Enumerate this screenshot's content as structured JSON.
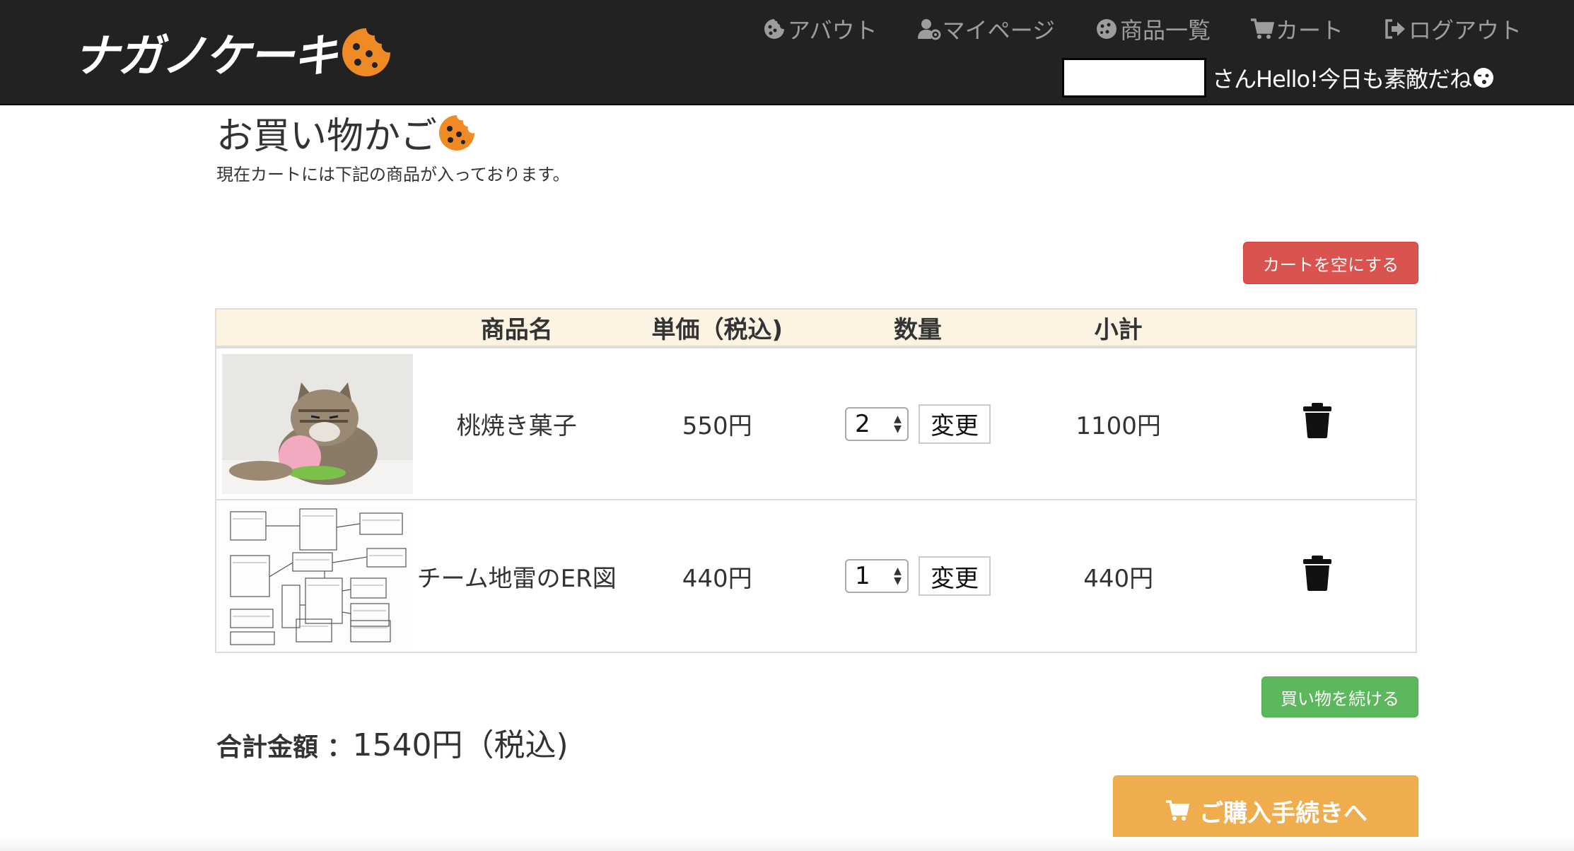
{
  "header": {
    "brand": "ナガノケーキ",
    "nav": [
      {
        "label": "アバウト",
        "icon": "cookie-icon"
      },
      {
        "label": "マイページ",
        "icon": "user-gear-icon"
      },
      {
        "label": "商品一覧",
        "icon": "cookie-icon"
      },
      {
        "label": "カート",
        "icon": "cart-icon"
      },
      {
        "label": "ログアウト",
        "icon": "sign-out-icon"
      }
    ],
    "greeting": "さんHello!今日も素敵だね"
  },
  "page": {
    "title": "お買い物かご",
    "subtitle": "現在カートには下記の商品が入っております。",
    "empty_cart_label": "カートを空にする",
    "continue_label": "買い物を続ける",
    "checkout_label": "ご購入手続きへ"
  },
  "table": {
    "headers": [
      "商品名",
      "単価（税込)",
      "数量",
      "小計"
    ],
    "rows": [
      {
        "name": "桃焼き菓子",
        "price": "550円",
        "qty": "2",
        "change": "変更",
        "subtotal": "1100円",
        "image": "cat-with-peach-photo"
      },
      {
        "name": "チーム地雷のER図",
        "price": "440円",
        "qty": "1",
        "change": "変更",
        "subtotal": "440円",
        "image": "er-diagram-image"
      }
    ]
  },
  "total": {
    "label": "合計金額 ：",
    "value": "1540円（税込)"
  },
  "colors": {
    "navbar": "#222222",
    "danger": "#d9534f",
    "success": "#5cb85c",
    "warning": "#f0ad4e",
    "table_header": "#fcf3e3",
    "cookie": "#f08a24"
  }
}
